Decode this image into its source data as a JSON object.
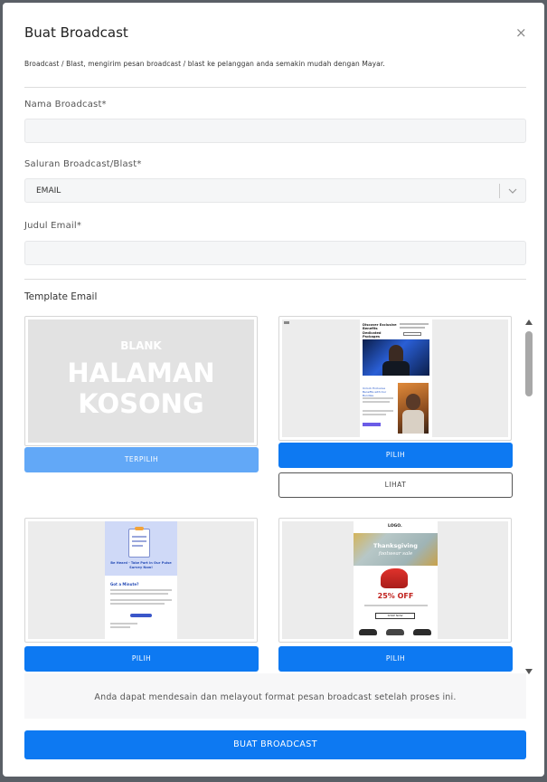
{
  "modal": {
    "title": "Buat Broadcast",
    "close_icon": "×",
    "description": "Broadcast / Blast, mengirim pesan broadcast / blast ke pelanggan anda semakin mudah dengan Mayar."
  },
  "form": {
    "name_label": "Nama Broadcast*",
    "name_value": "",
    "channel_label": "Saluran Broadcast/Blast*",
    "channel_value": "EMAIL",
    "subject_label": "Judul Email*",
    "subject_value": ""
  },
  "templates": {
    "section_label": "Template Email",
    "blank_word": "BLANK",
    "blank_line1": "HALAMAN",
    "blank_line2": "KOSONG",
    "selected_label": "TERPILIH",
    "choose_label": "PILIH",
    "view_label": "LIHAT",
    "t2": {
      "heading": "Discover Exclusive Benefits Dedicated Packages",
      "subheading": "Unlock Exclusive Benefits with Our Bundles"
    },
    "t3": {
      "heading": "Be Heard - Take Part in Our Pulse Survey Now!",
      "subheading": "Got a Minute?"
    },
    "t4": {
      "logo": "LOGO.",
      "heading": "Thanksgiving",
      "script": "footwear sale",
      "discount": "25% OFF",
      "cta": "SHOP NOW"
    }
  },
  "note": "Anda dapat mendesain dan melayout format pesan broadcast setelah proses ini.",
  "submit_label": "BUAT BROADCAST",
  "colors": {
    "primary": "#0d79f2",
    "primary_light": "#62a8f7"
  }
}
